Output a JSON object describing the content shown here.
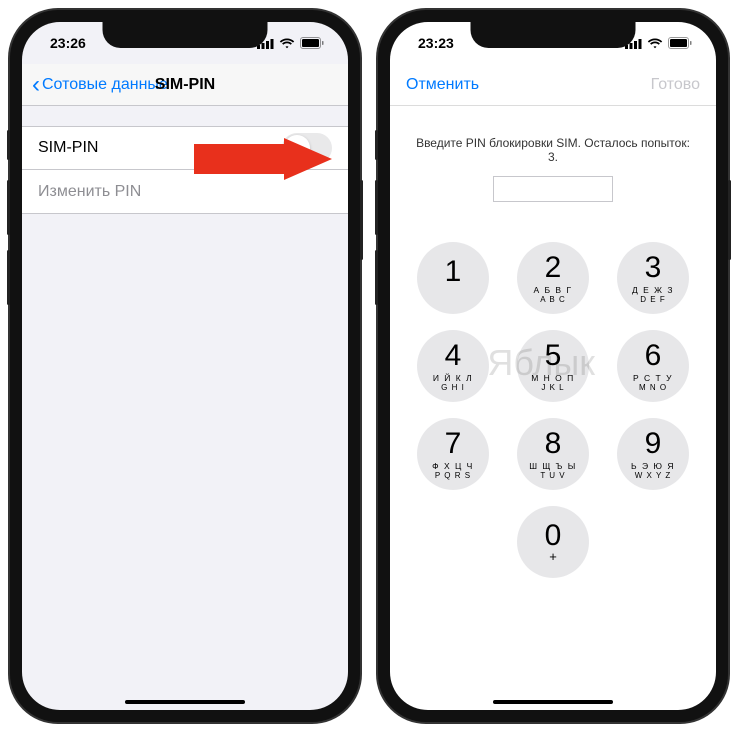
{
  "watermark": "Яблык",
  "left": {
    "time": "23:26",
    "back_label": "Сотовые данные",
    "title": "SIM-PIN",
    "row_sim_pin": "SIM-PIN",
    "row_change_pin": "Изменить PIN",
    "toggle_on": false
  },
  "right": {
    "time": "23:23",
    "cancel": "Отменить",
    "done": "Готово",
    "instruction": "Введите PIN блокировки SIM. Осталось попыток: 3.",
    "keys": [
      {
        "num": "1",
        "ru": "",
        "en": ""
      },
      {
        "num": "2",
        "ru": "А Б В Г",
        "en": "A B C"
      },
      {
        "num": "3",
        "ru": "Д Е Ж З",
        "en": "D E F"
      },
      {
        "num": "4",
        "ru": "И Й К Л",
        "en": "G H I"
      },
      {
        "num": "5",
        "ru": "М Н О П",
        "en": "J K L"
      },
      {
        "num": "6",
        "ru": "Р С Т У",
        "en": "M N O"
      },
      {
        "num": "7",
        "ru": "Ф Х Ц Ч",
        "en": "P Q R S"
      },
      {
        "num": "8",
        "ru": "Ш Щ Ъ Ы",
        "en": "T U V"
      },
      {
        "num": "9",
        "ru": "Ь Э Ю Я",
        "en": "W X Y Z"
      },
      {
        "num": "0",
        "ru": "",
        "en": "+"
      }
    ]
  }
}
